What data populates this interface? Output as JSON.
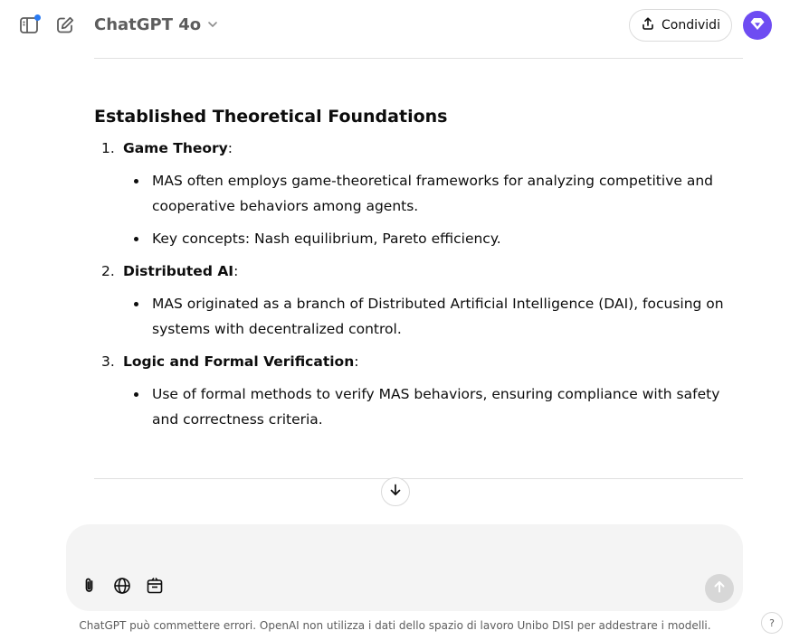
{
  "header": {
    "model_name": "ChatGPT 4o",
    "share_label": "Condividi"
  },
  "content": {
    "section_title": "Established Theoretical Foundations",
    "items": [
      {
        "number": "1.",
        "title": "Game Theory",
        "suffix": ":",
        "bullets": [
          "MAS often employs game-theoretical frameworks for analyzing competitive and cooperative behaviors among agents.",
          "Key concepts: Nash equilibrium, Pareto efficiency."
        ]
      },
      {
        "number": "2.",
        "title": "Distributed AI",
        "suffix": ":",
        "bullets": [
          "MAS originated as a branch of Distributed Artificial Intelligence (DAI), focusing on systems with decentralized control."
        ]
      },
      {
        "number": "3.",
        "title": "Logic and Formal Verification",
        "suffix": ":",
        "bullets": [
          "Use of formal methods to verify MAS behaviors, ensuring compliance with safety and correctness criteria."
        ]
      }
    ]
  },
  "composer": {
    "placeholder": "",
    "value": ""
  },
  "footer": {
    "disclaimer": "ChatGPT può commettere errori. OpenAI non utilizza i dati dello spazio di lavoro Unibo DISI per addestrare i modelli.",
    "help_label": "?"
  },
  "icons": {
    "sidebar": "sidebar-toggle-icon",
    "new_chat": "edit-icon",
    "model_dropdown": "chevron-down-icon",
    "share": "share-upload-icon",
    "avatar": "gpt-diamond-icon",
    "scroll_down": "arrow-down-icon",
    "attach": "paperclip-icon",
    "search": "globe-icon",
    "canvas": "canvas-icon",
    "send": "arrow-up-icon"
  },
  "colors": {
    "accent_dot": "#2b7bf3",
    "avatar_bg": "#6e4cf2",
    "composer_bg": "#f4f4f4",
    "send_disabled": "#d7d7d7"
  }
}
